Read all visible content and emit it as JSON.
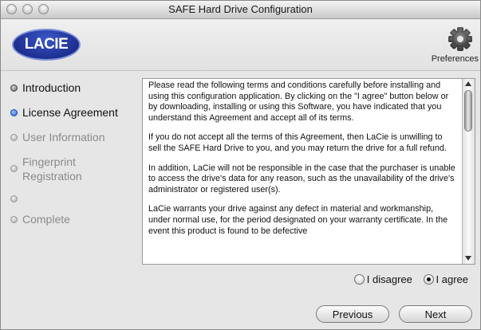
{
  "window": {
    "title": "SAFE Hard Drive Configuration"
  },
  "header": {
    "logo_text": "LACIE",
    "preferences_label": "Preferences",
    "preferences_icon": "gear-icon"
  },
  "steps": [
    {
      "label": "Introduction",
      "state": "done"
    },
    {
      "label": "License Agreement",
      "state": "current"
    },
    {
      "label": "User Information",
      "state": "future"
    },
    {
      "label": "Fingerprint Registration",
      "state": "future"
    },
    {
      "label": "",
      "state": "future"
    },
    {
      "label": "Complete",
      "state": "future"
    }
  ],
  "license": {
    "paragraphs": [
      "Please read the following terms and conditions carefully before installing and using this configuration application. By clicking on the \"I agree\" button below or by downloading, installing or using this Software, you have indicated that you understand this Agreement and accept all of its terms.",
      "If you do not accept all the terms of this Agreement, then LaCie is unwilling to sell the SAFE Hard Drive to you, and you may return the drive for a full refund.",
      "In addition, LaCie will not be responsible in the case that the purchaser is unable to access the drive's data for any reason, such as the unavailability of the drive's administrator or registered user(s).",
      "LaCie warrants your drive against any defect in material and workmanship, under normal use, for the period designated on your warranty certificate. In the event this product is found to be defective"
    ]
  },
  "options": {
    "disagree_label": "I disagree",
    "agree_label": "I agree",
    "selected": "agree"
  },
  "buttons": {
    "previous_label": "Previous",
    "next_label": "Next"
  }
}
